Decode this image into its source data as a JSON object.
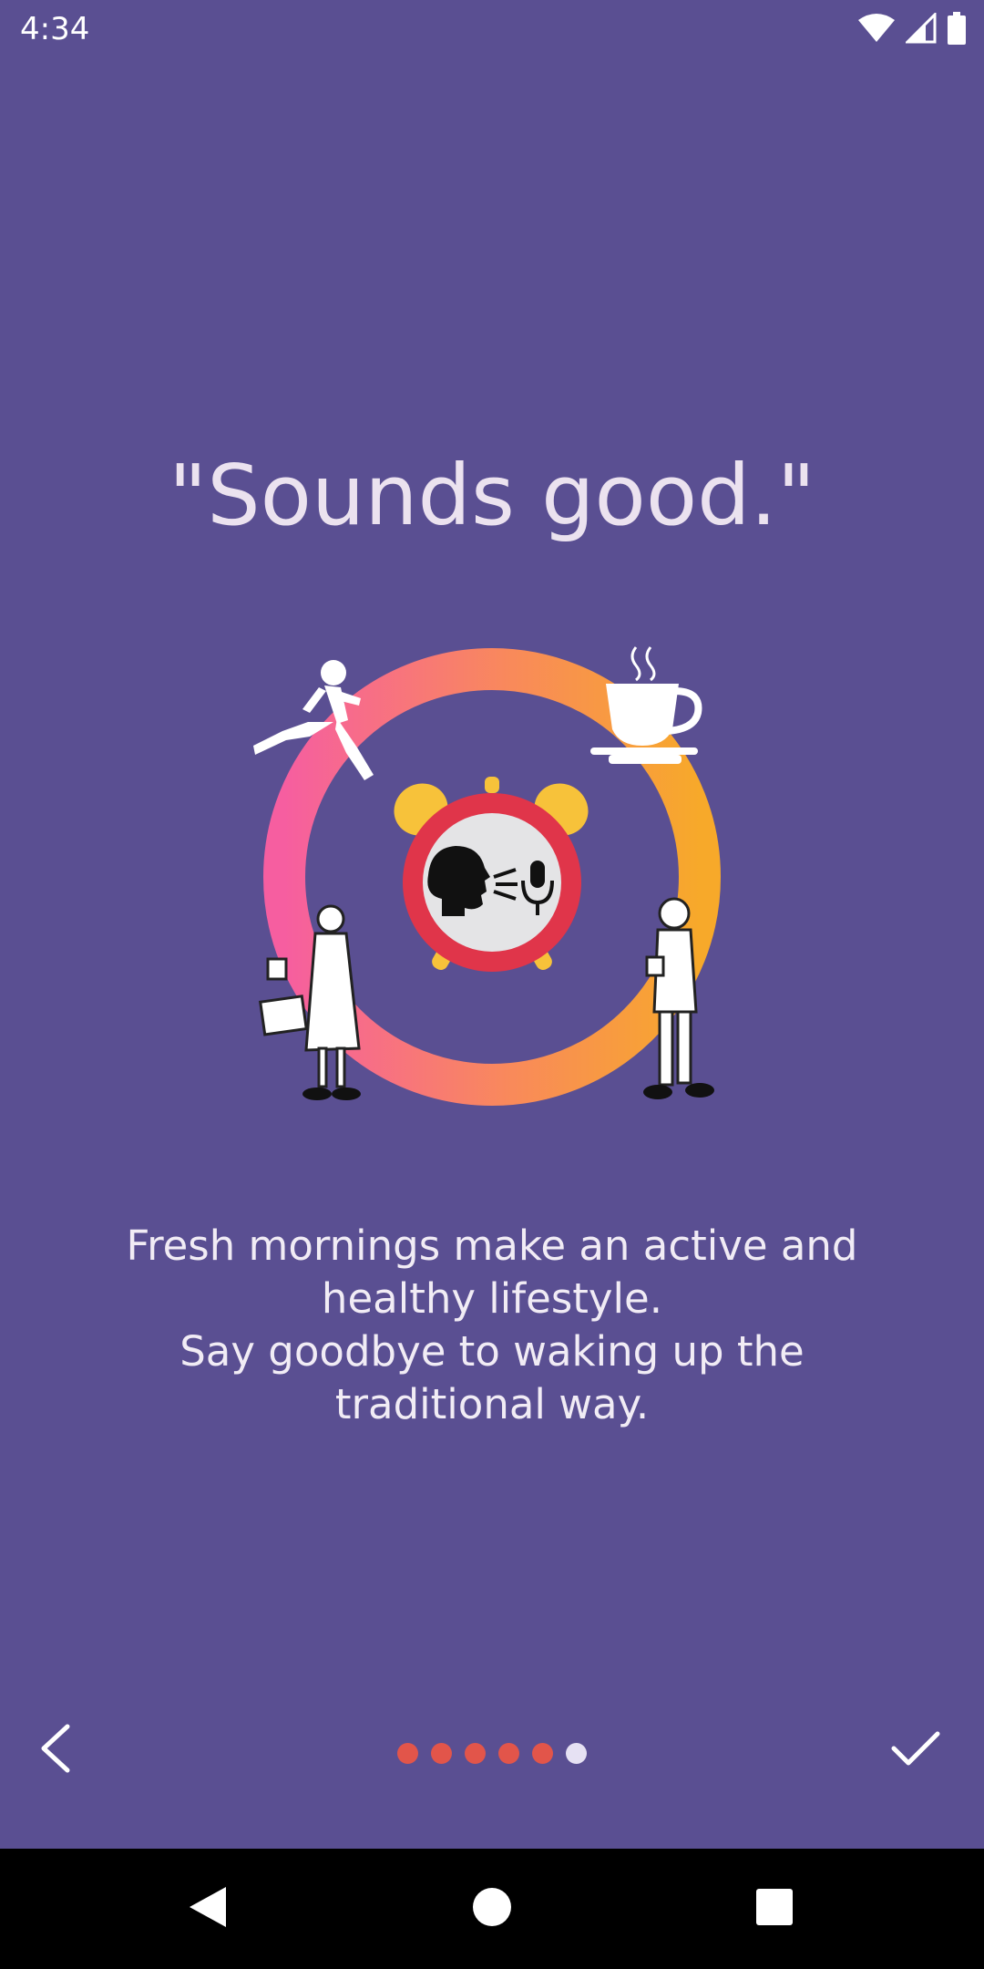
{
  "status_bar": {
    "time": "4:34",
    "icons": [
      "wifi-icon",
      "cell-signal-icon",
      "battery-icon"
    ]
  },
  "onboarding": {
    "title": "\"Sounds good.\"",
    "description_lines": [
      "Fresh mornings make an active and",
      "healthy lifestyle.",
      "Say goodbye to waking up the",
      "traditional way."
    ],
    "illustration": "alarm-clock-voice-illustration"
  },
  "pager": {
    "total_pages": 6,
    "current_page": 6,
    "active_color": "#e2554a",
    "inactive_color": "#e6e1f3"
  },
  "navigation": {
    "back": "chevron-left-icon",
    "done": "checkmark-icon"
  },
  "system_nav": {
    "buttons": [
      "back-triangle-icon",
      "home-circle-icon",
      "recents-square-icon"
    ]
  },
  "colors": {
    "background": "#5a4f92",
    "ring_start": "#f65ea0",
    "ring_end": "#f7a531",
    "clock_red": "#e0354a",
    "bell_yellow": "#f7c23a"
  }
}
